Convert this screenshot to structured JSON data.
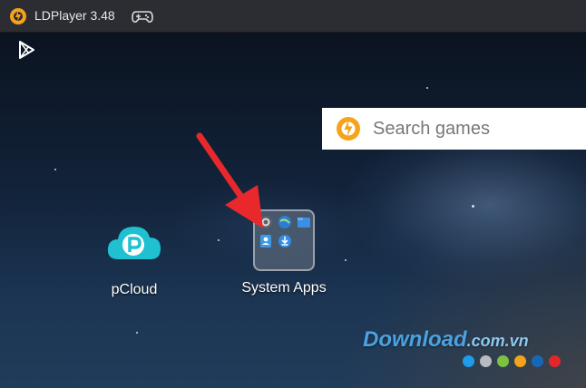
{
  "window": {
    "title": "LDPlayer 3.48",
    "logo_icon": "ldplayer-logo-icon",
    "gamepad_icon": "gamepad-icon"
  },
  "desktop": {
    "playstore_icon": "play-store-icon",
    "search": {
      "placeholder": "Search games",
      "icon": "ldplayer-search-logo-icon"
    },
    "apps": [
      {
        "label": "pCloud",
        "icon": "pcloud-icon"
      },
      {
        "label": "System Apps",
        "icon": "folder-icon"
      }
    ],
    "annotation": {
      "icon": "red-arrow-icon",
      "color": "#e8282b"
    }
  },
  "watermark": {
    "main": "Download",
    "domain": ".com.vn",
    "dot_colors": [
      "#1e9be9",
      "#b9bcbf",
      "#7cc242",
      "#f5a31a",
      "#1668b6",
      "#e3262c"
    ]
  }
}
